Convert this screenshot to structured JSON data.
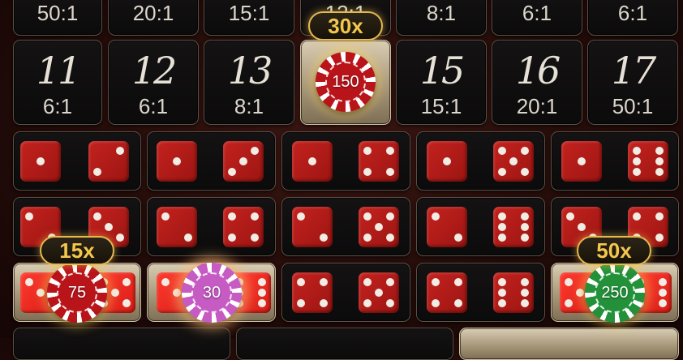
{
  "top_row_odds": [
    "50:1",
    "20:1",
    "15:1",
    "12:1",
    "8:1",
    "6:1",
    "6:1"
  ],
  "totals": [
    {
      "number": "11",
      "odds": "6:1"
    },
    {
      "number": "12",
      "odds": "6:1"
    },
    {
      "number": "13",
      "odds": "8:1"
    },
    {
      "number": "",
      "odds": "12:1"
    },
    {
      "number": "15",
      "odds": "15:1"
    },
    {
      "number": "16",
      "odds": "20:1"
    },
    {
      "number": "17",
      "odds": "50:1"
    }
  ],
  "chips": {
    "total_14": "150",
    "combo_left": "75",
    "combo_second": "30",
    "combo_right": "250"
  },
  "multipliers": {
    "total_14": "30x",
    "combo_left": "15x",
    "combo_right": "50x"
  },
  "colors": {
    "die_red": "#b81c18",
    "chip_red": "#b8141a",
    "chip_pink": "#c65bc4",
    "chip_green": "#23913a",
    "multiplier_gold": "#f3c64d"
  }
}
